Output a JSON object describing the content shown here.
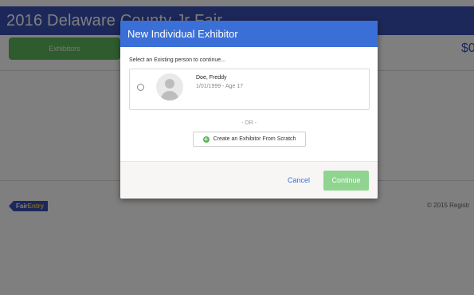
{
  "header": {
    "title": "2016 Delaware County Jr Fair"
  },
  "nav": {
    "exhibitors_tab": "Exhibitors",
    "total_partial": "$0"
  },
  "footer": {
    "brand": {
      "fair": "Fair",
      "entry": "Entry"
    },
    "copyright": "© 2015 Registr"
  },
  "modal": {
    "title": "New Individual Exhibitor",
    "select_label": "Select an Existing person to continue...",
    "people": [
      {
        "name": "Doe, Freddy",
        "meta": "1/01/1999 - Age 17",
        "selected": false
      }
    ],
    "or_text": "- OR -",
    "create_button": "Create an Exhibitor From Scratch",
    "cancel_label": "Cancel",
    "continue_label": "Continue"
  },
  "colors": {
    "header_bg": "#3b51b5",
    "modal_header_bg": "#3b6fd8",
    "green": "#5cb85c",
    "continue_disabled": "#8fd58f"
  },
  "icons": [
    "user-avatar-icon",
    "plus-circle-icon",
    "radio-button-icon"
  ]
}
